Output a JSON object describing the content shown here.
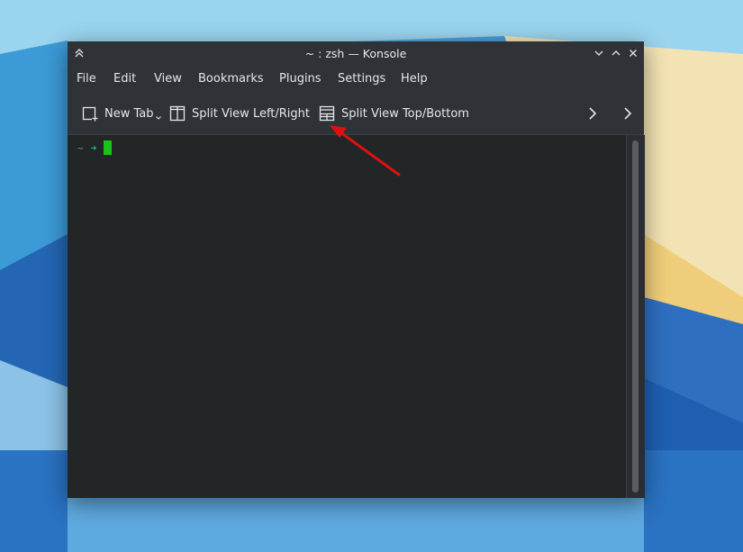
{
  "window": {
    "title": "~ : zsh — Konsole"
  },
  "titlebar": {
    "keep_above_icon": "double-chevron-up-icon",
    "minimize_icon": "chevron-down-icon",
    "maximize_icon": "chevron-up-icon",
    "close_icon": "close-icon"
  },
  "menubar": {
    "items": [
      "File",
      "Edit",
      "View",
      "Bookmarks",
      "Plugins",
      "Settings",
      "Help"
    ]
  },
  "toolbar": {
    "new_tab": "New Tab",
    "split_left_right": "Split View Left/Right",
    "split_top_bottom": "Split View Top/Bottom"
  },
  "terminal": {
    "prompt_dir": "~",
    "prompt_arrow": "➜"
  },
  "colors": {
    "annotation_arrow": "#e01010",
    "cursor": "#18c41a",
    "terminal_bg": "#232627",
    "chrome_bg": "#2f3337"
  }
}
